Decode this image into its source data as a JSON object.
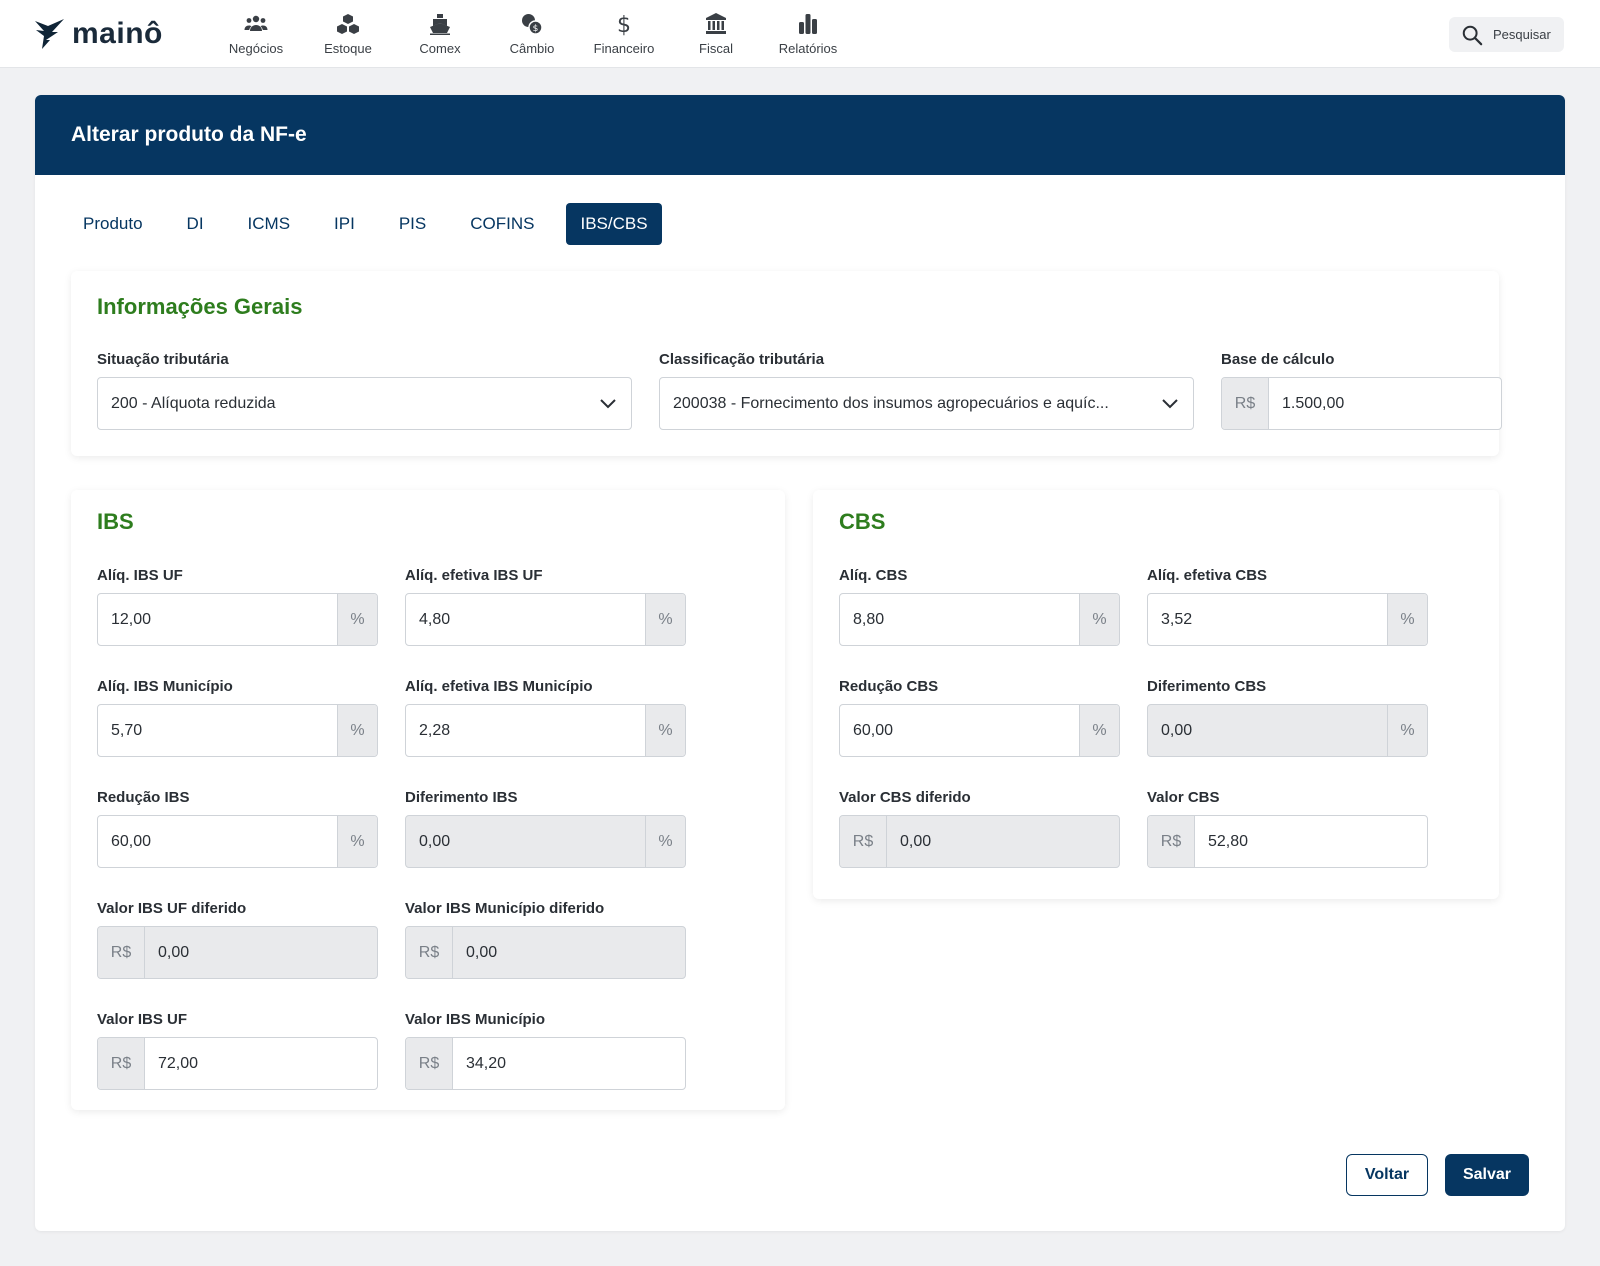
{
  "brand": {
    "name": "mainô"
  },
  "nav": {
    "items": [
      {
        "label": "Negócios",
        "icon": "users-icon"
      },
      {
        "label": "Estoque",
        "icon": "boxes-icon"
      },
      {
        "label": "Comex",
        "icon": "ship-icon"
      },
      {
        "label": "Câmbio",
        "icon": "coins-icon"
      },
      {
        "label": "Financeiro",
        "icon": "dollar-icon"
      },
      {
        "label": "Fiscal",
        "icon": "bank-icon"
      },
      {
        "label": "Relatórios",
        "icon": "bar-chart-icon"
      }
    ],
    "search_label": "Pesquisar"
  },
  "page": {
    "title": "Alterar produto da NF-e",
    "tabs": [
      "Produto",
      "DI",
      "ICMS",
      "IPI",
      "PIS",
      "COFINS",
      "IBS/CBS"
    ],
    "active_tab": "IBS/CBS"
  },
  "general": {
    "title": "Informações Gerais",
    "situacao": {
      "label": "Situação tributária",
      "value": "200 - Alíquota reduzida"
    },
    "classificacao": {
      "label": "Classificação tributária",
      "value": "200038 - Fornecimento dos insumos agropecuários e aquíc..."
    },
    "base": {
      "label": "Base de cálculo",
      "prefix": "R$",
      "value": "1.500,00"
    }
  },
  "ibs": {
    "title": "IBS",
    "aliq_uf": {
      "label": "Alíq. IBS UF",
      "value": "12,00",
      "suffix": "%"
    },
    "aliq_efetiva_uf": {
      "label": "Alíq. efetiva IBS UF",
      "value": "4,80",
      "suffix": "%"
    },
    "aliq_mun": {
      "label": "Alíq. IBS Município",
      "value": "5,70",
      "suffix": "%"
    },
    "aliq_efetiva_mun": {
      "label": "Alíq. efetiva IBS Município",
      "value": "2,28",
      "suffix": "%"
    },
    "reducao": {
      "label": "Redução IBS",
      "value": "60,00",
      "suffix": "%"
    },
    "diferimento": {
      "label": "Diferimento IBS",
      "value": "0,00",
      "suffix": "%"
    },
    "valor_uf_diferido": {
      "label": "Valor IBS UF diferido",
      "prefix": "R$",
      "value": "0,00"
    },
    "valor_mun_diferido": {
      "label": "Valor IBS Município diferido",
      "prefix": "R$",
      "value": "0,00"
    },
    "valor_uf": {
      "label": "Valor IBS UF",
      "prefix": "R$",
      "value": "72,00"
    },
    "valor_mun": {
      "label": "Valor IBS Município",
      "prefix": "R$",
      "value": "34,20"
    }
  },
  "cbs": {
    "title": "CBS",
    "aliq": {
      "label": "Alíq. CBS",
      "value": "8,80",
      "suffix": "%"
    },
    "aliq_efetiva": {
      "label": "Alíq. efetiva CBS",
      "value": "3,52",
      "suffix": "%"
    },
    "reducao": {
      "label": "Redução CBS",
      "value": "60,00",
      "suffix": "%"
    },
    "diferimento": {
      "label": "Diferimento CBS",
      "value": "0,00",
      "suffix": "%"
    },
    "valor_diferido": {
      "label": "Valor CBS diferido",
      "prefix": "R$",
      "value": "0,00"
    },
    "valor": {
      "label": "Valor CBS",
      "prefix": "R$",
      "value": "52,80"
    }
  },
  "actions": {
    "back_label": "Voltar",
    "save_label": "Salvar"
  },
  "colors": {
    "primary": "#063661",
    "section_title": "#2e7d1e"
  }
}
